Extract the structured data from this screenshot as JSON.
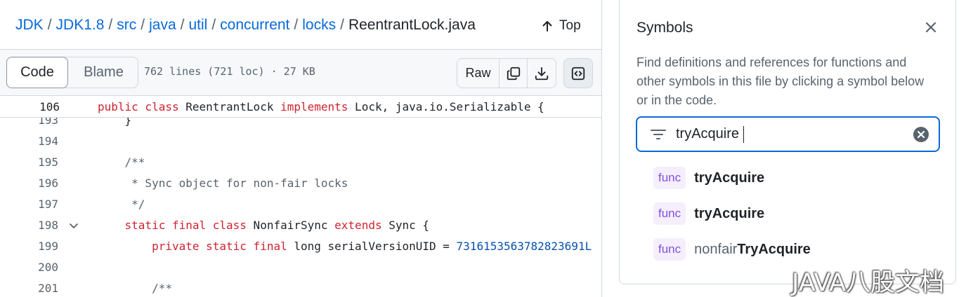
{
  "breadcrumb": {
    "items": [
      "JDK",
      "JDK1.8",
      "src",
      "java",
      "util",
      "concurrent",
      "locks"
    ],
    "file": "ReentrantLock.java",
    "separator": "/"
  },
  "top_button": {
    "label": "Top",
    "icon": "arrow-up-icon"
  },
  "toolbar": {
    "code_tab": "Code",
    "blame_tab": "Blame",
    "file_info": "762 lines (721 loc) · 27 KB",
    "raw_label": "Raw",
    "copy_icon": "copy-icon",
    "download_icon": "download-icon",
    "symbols_icon": "code-square-icon"
  },
  "sticky_line": {
    "number": "106",
    "tokens": [
      {
        "t": "public class",
        "c": "kw"
      },
      {
        "t": " ReentrantLock ",
        "c": ""
      },
      {
        "t": "implements",
        "c": "kw"
      },
      {
        "t": " Lock, java.io.Serializable {",
        "c": ""
      }
    ]
  },
  "code_lines": [
    {
      "number": "193",
      "fold": false,
      "tokens": [
        {
          "t": "    }",
          "c": ""
        }
      ]
    },
    {
      "number": "194",
      "fold": false,
      "tokens": []
    },
    {
      "number": "195",
      "fold": false,
      "tokens": [
        {
          "t": "    /**",
          "c": "cm"
        }
      ]
    },
    {
      "number": "196",
      "fold": false,
      "tokens": [
        {
          "t": "     * Sync object for non-fair locks",
          "c": "cm"
        }
      ]
    },
    {
      "number": "197",
      "fold": false,
      "tokens": [
        {
          "t": "     */",
          "c": "cm"
        }
      ]
    },
    {
      "number": "198",
      "fold": true,
      "tokens": [
        {
          "t": "    static final class",
          "c": "kw"
        },
        {
          "t": " NonfairSync ",
          "c": ""
        },
        {
          "t": "extends",
          "c": "kw"
        },
        {
          "t": " Sync {",
          "c": ""
        }
      ]
    },
    {
      "number": "199",
      "fold": false,
      "tokens": [
        {
          "t": "        private static final",
          "c": "kw"
        },
        {
          "t": " long serialVersionUID = ",
          "c": ""
        },
        {
          "t": "7316153563782823691L",
          "c": "num"
        }
      ]
    },
    {
      "number": "200",
      "fold": false,
      "tokens": []
    },
    {
      "number": "201",
      "fold": false,
      "tokens": [
        {
          "t": "        /**",
          "c": "cm"
        }
      ]
    }
  ],
  "symbols_panel": {
    "title": "Symbols",
    "close_icon": "close-icon",
    "description": "Find definitions and references for functions and other symbols in this file by clicking a symbol below or in the code.",
    "filter_icon": "filter-icon",
    "search_value": "tryAcquire",
    "clear_icon": "clear-circle-icon",
    "results": [
      {
        "kind": "func",
        "prefix": "",
        "match": "tryAcquire"
      },
      {
        "kind": "func",
        "prefix": "",
        "match": "tryAcquire"
      },
      {
        "kind": "func",
        "prefix": "nonfair",
        "match": "TryAcquire"
      }
    ]
  },
  "watermark": "JAVA八股文档",
  "colors": {
    "link": "#0969da",
    "keyword": "#cf222e",
    "comment": "#59636e",
    "number": "#0550ae",
    "badge_bg": "#f5eefc",
    "badge_text": "#8250df",
    "focus": "#0969da"
  }
}
